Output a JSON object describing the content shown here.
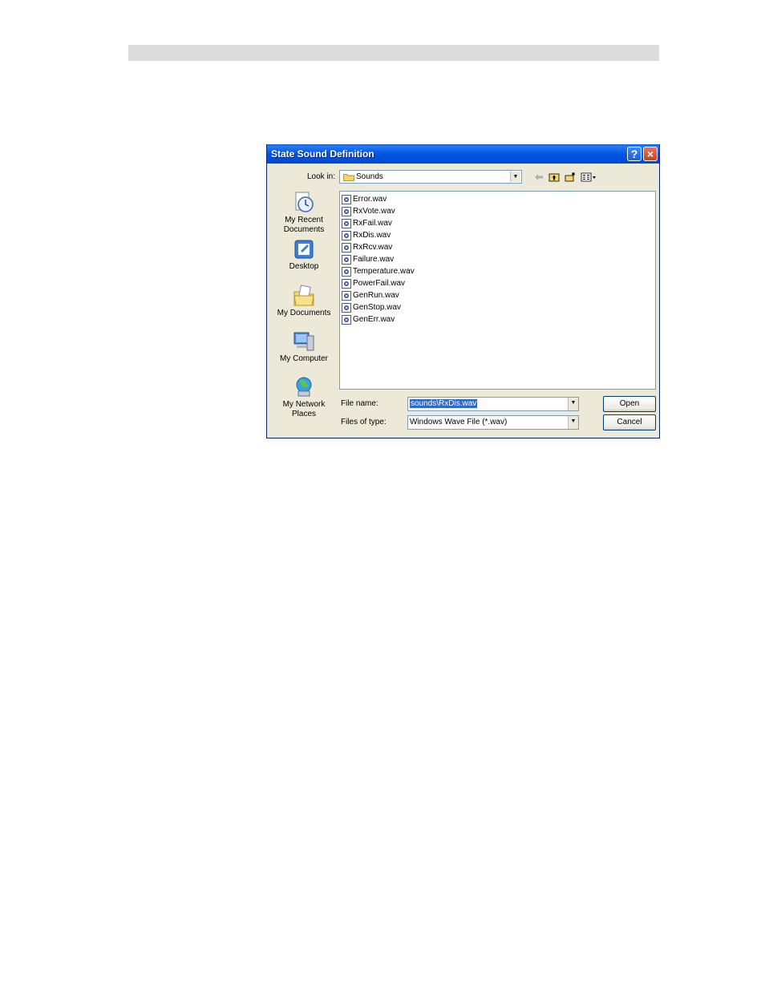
{
  "dialog": {
    "title": "State Sound Definition",
    "help_label": "?",
    "close_label": "×"
  },
  "look_in": {
    "label": "Look in:",
    "value": "Sounds"
  },
  "places": [
    {
      "label_line1": "My Recent",
      "label_line2": "Documents",
      "icon": "recent-documents-icon"
    },
    {
      "label_line1": "Desktop",
      "label_line2": "",
      "icon": "desktop-icon"
    },
    {
      "label_line1": "My Documents",
      "label_line2": "",
      "icon": "my-documents-icon"
    },
    {
      "label_line1": "My Computer",
      "label_line2": "",
      "icon": "my-computer-icon"
    },
    {
      "label_line1": "My Network",
      "label_line2": "Places",
      "icon": "network-places-icon"
    }
  ],
  "files": [
    "Error.wav",
    "RxVote.wav",
    "RxFail.wav",
    "RxDis.wav",
    "RxRcv.wav",
    "Failure.wav",
    "Temperature.wav",
    "PowerFail.wav",
    "GenRun.wav",
    "GenStop.wav",
    "GenErr.wav"
  ],
  "file_name": {
    "label": "File name:",
    "value": "sounds\\RxDis.wav"
  },
  "file_type": {
    "label": "Files of type:",
    "value": "Windows Wave File (*.wav)"
  },
  "buttons": {
    "open": "Open",
    "cancel": "Cancel"
  },
  "colors": {
    "titlebar": "#0055e5",
    "dialog_bg": "#ece9d8",
    "selection": "#316ac5"
  }
}
